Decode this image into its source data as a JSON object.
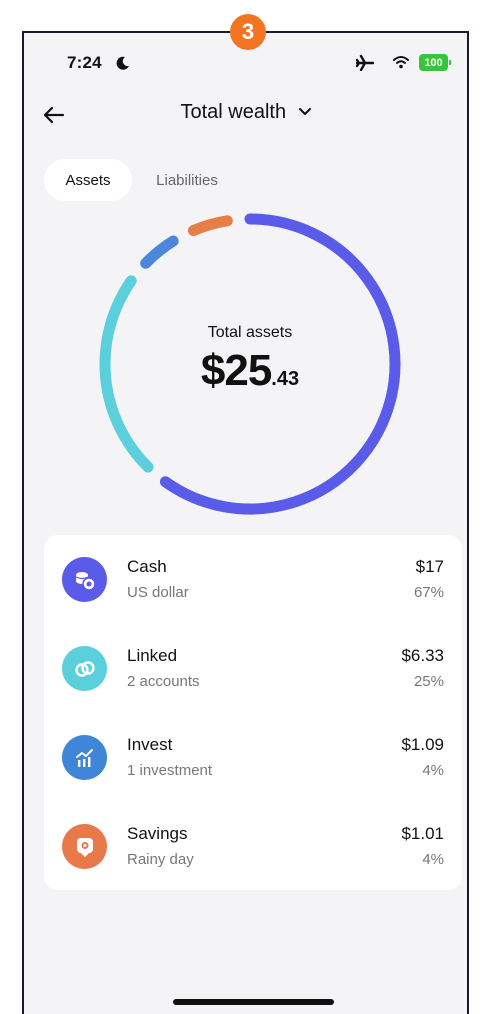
{
  "step_badge": "3",
  "status_bar": {
    "time": "7:24",
    "battery": "100",
    "icons": [
      "moon-icon",
      "airplane-icon",
      "wifi-icon",
      "battery-icon"
    ]
  },
  "header": {
    "title": "Total wealth",
    "back_icon": "back-arrow-icon",
    "dropdown_icon": "chevron-down-icon"
  },
  "tabs": [
    {
      "label": "Assets",
      "selected": true
    },
    {
      "label": "Liabilities",
      "selected": false
    }
  ],
  "summary": {
    "label": "Total assets",
    "amount_main": "$25",
    "amount_cents": ".43"
  },
  "chart_data": {
    "type": "pie",
    "variant": "donut",
    "categories": [
      "Cash",
      "Linked",
      "Invest",
      "Savings"
    ],
    "values": [
      17,
      6.33,
      1.09,
      1.01
    ],
    "colors": [
      "#5b5bea",
      "#5ccfdd",
      "#4b88dc",
      "#e67f45"
    ]
  },
  "items": [
    {
      "title": "Cash",
      "subtitle": "US dollar",
      "amount": "$17",
      "percent": "67%",
      "color": "#5b5bea",
      "icon": "coins-icon"
    },
    {
      "title": "Linked",
      "subtitle": "2 accounts",
      "amount": "$6.33",
      "percent": "25%",
      "color": "#5ccfdd",
      "icon": "link-icon"
    },
    {
      "title": "Invest",
      "subtitle": "1 investment",
      "amount": "$1.09",
      "percent": "4%",
      "color": "#3f86d9",
      "icon": "chart-growth-icon"
    },
    {
      "title": "Savings",
      "subtitle": "Rainy day",
      "amount": "$1.01",
      "percent": "4%",
      "color": "#e8794a",
      "icon": "piggy-bank-icon"
    }
  ]
}
